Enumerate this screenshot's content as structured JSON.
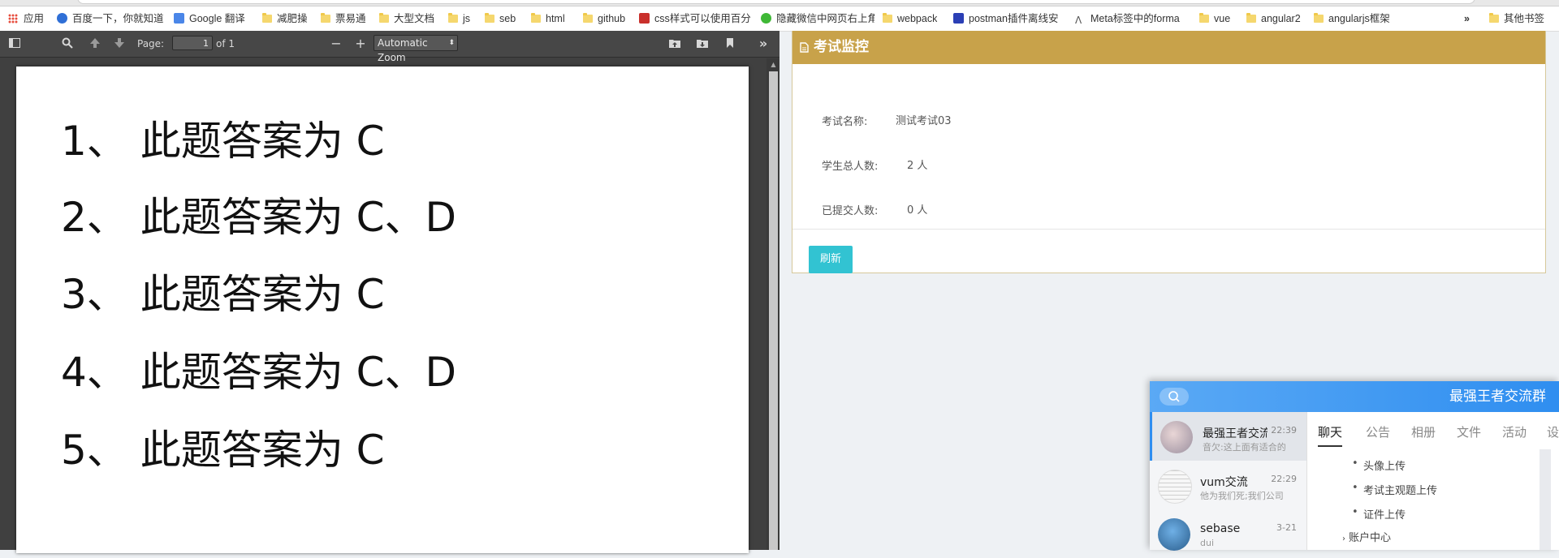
{
  "bookmarks": [
    {
      "label": "应用",
      "icon": "apps-grid-icon"
    },
    {
      "label": "百度一下，你就知道",
      "icon": "baidu-icon"
    },
    {
      "label": "Google 翻译",
      "icon": "google-translate-icon"
    },
    {
      "label": "减肥操",
      "icon": "folder-icon"
    },
    {
      "label": "票易通",
      "icon": "folder-icon"
    },
    {
      "label": "大型文档",
      "icon": "folder-icon"
    },
    {
      "label": "js",
      "icon": "folder-icon"
    },
    {
      "label": "seb",
      "icon": "folder-icon"
    },
    {
      "label": "html",
      "icon": "folder-icon"
    },
    {
      "label": "github",
      "icon": "folder-icon"
    },
    {
      "label": "css样式可以使用百分",
      "icon": "css-site-icon"
    },
    {
      "label": "隐藏微信中网页右上角",
      "icon": "wechat-icon"
    },
    {
      "label": "webpack",
      "icon": "folder-icon"
    },
    {
      "label": "postman插件离线安",
      "icon": "baidu-paw-icon"
    },
    {
      "label": "Meta标签中的forma",
      "icon": "link-icon"
    },
    {
      "label": "vue",
      "icon": "folder-icon"
    },
    {
      "label": "angular2",
      "icon": "folder-icon"
    },
    {
      "label": "angularjs框架",
      "icon": "folder-icon"
    },
    {
      "label": "»",
      "icon": "overflow-chevron-icon"
    },
    {
      "label": "其他书签",
      "icon": "folder-icon"
    }
  ],
  "pdf_viewer": {
    "page_label": "Page:",
    "page_value": "1",
    "page_of": "of 1",
    "zoom_label": "Automatic Zoom",
    "lines": [
      "1、 此题答案为 C",
      "2、 此题答案为 C、D",
      "3、 此题答案为 C",
      "4、 此题答案为 C、D",
      "5、 此题答案为 C"
    ]
  },
  "exam_monitor": {
    "title": "考试监控",
    "fields": [
      {
        "label": "考试名称:",
        "value": "测试考试03"
      },
      {
        "label": "学生总人数:",
        "value": "2 人"
      },
      {
        "label": "已提交人数:",
        "value": "0 人"
      }
    ],
    "refresh_label": "刷新"
  },
  "chat": {
    "title": "最强王者交流群",
    "conversations": [
      {
        "name": "最强王者交流群",
        "time": "22:39",
        "message": "音欠:这上面有适合的",
        "active": true
      },
      {
        "name": "vum交流",
        "time": "22:29",
        "message": "他为我们死;我们公司",
        "active": false
      },
      {
        "name": "sebase",
        "time": "3-21",
        "message": "dui",
        "active": false
      }
    ],
    "tabs": [
      "聊天",
      "公告",
      "相册",
      "文件",
      "活动",
      "设"
    ],
    "active_tab": 0,
    "list_items": [
      "头像上传",
      "考试主观题上传",
      "证件上传"
    ],
    "section_label": "账户中心"
  },
  "colors": {
    "panel_header": "#c8a24a",
    "refresh_button": "#32c3d2",
    "chat_header": "#2f8ef0",
    "pdf_background": "#404040"
  }
}
